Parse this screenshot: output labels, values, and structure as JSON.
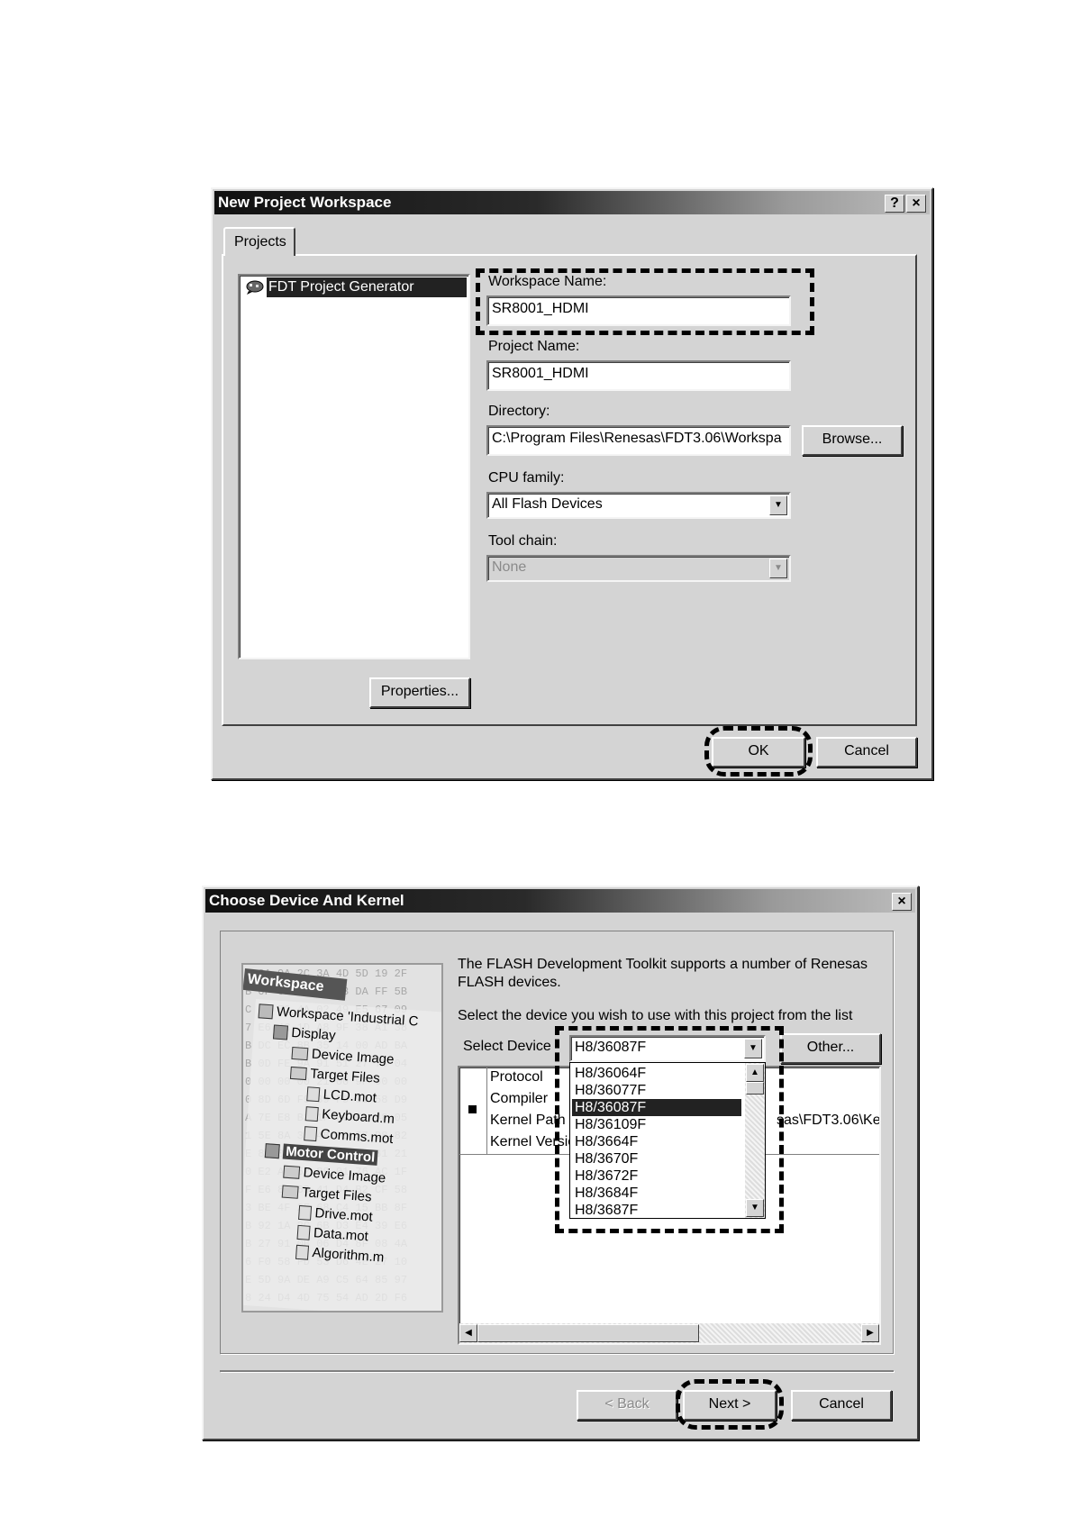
{
  "dialog1": {
    "title": "New Project Workspace",
    "help_label": "?",
    "close_label": "×",
    "tab_projects": "Projects",
    "project_types": [
      "FDT Project Generator"
    ],
    "workspace_name_label": "Workspace Name:",
    "workspace_name_value": "SR8001_HDMI",
    "project_name_label": "Project Name:",
    "project_name_value": "SR8001_HDMI",
    "directory_label": "Directory:",
    "directory_value": "C:\\Program Files\\Renesas\\FDT3.06\\Workspa",
    "browse_label": "Browse...",
    "cpu_family_label": "CPU family:",
    "cpu_family_value": "All Flash Devices",
    "tool_chain_label": "Tool chain:",
    "tool_chain_value": "None",
    "properties_label": "Properties...",
    "ok_label": "OK",
    "cancel_label": "Cancel"
  },
  "dialog2": {
    "title": "Choose Device And Kernel",
    "close_label": "×",
    "intro_text": "The FLASH Development Toolkit supports a number of Renesas FLASH devices.",
    "select_prompt": "Select the device you wish to use with this project from the list",
    "select_device_label": "Select Device",
    "selected_device": "H8/36087F",
    "other_label": "Other...",
    "device_list": [
      "H8/36064F",
      "H8/36077F",
      "H8/36087F",
      "H8/36109F",
      "H8/3664F",
      "H8/3670F",
      "H8/3672F",
      "H8/3684F",
      "H8/3687F"
    ],
    "selected_index": 2,
    "info_rows": [
      {
        "label": "Protocol"
      },
      {
        "label": "Compiler"
      },
      {
        "label": "Kernel Path",
        "value": "sas\\FDT3.06\\Ke"
      },
      {
        "label": "Kernel Version"
      }
    ],
    "back_label": "< Back",
    "next_label": "Next >",
    "cancel_label": "Cancel",
    "sidebar": {
      "header": "Workspace",
      "items": [
        {
          "label": "Workspace 'Industrial C",
          "icon": "workspace-icon"
        },
        {
          "label": "Display",
          "icon": "project-icon"
        },
        {
          "label": "Device Image",
          "icon": "folder-icon"
        },
        {
          "label": "Target Files",
          "icon": "folder-icon"
        },
        {
          "label": "LCD.mot",
          "icon": "file-icon"
        },
        {
          "label": "Keyboard.m",
          "icon": "file-icon"
        },
        {
          "label": "Comms.mot",
          "icon": "file-icon"
        },
        {
          "label": "Motor Control",
          "icon": "project-icon"
        },
        {
          "label": "Device Image",
          "icon": "folder-icon"
        },
        {
          "label": "Target Files",
          "icon": "folder-icon"
        },
        {
          "label": "Drive.mot",
          "icon": "file-icon"
        },
        {
          "label": "Data.mot",
          "icon": "file-icon"
        },
        {
          "label": "Algorithm.m",
          "icon": "file-icon"
        }
      ]
    }
  }
}
